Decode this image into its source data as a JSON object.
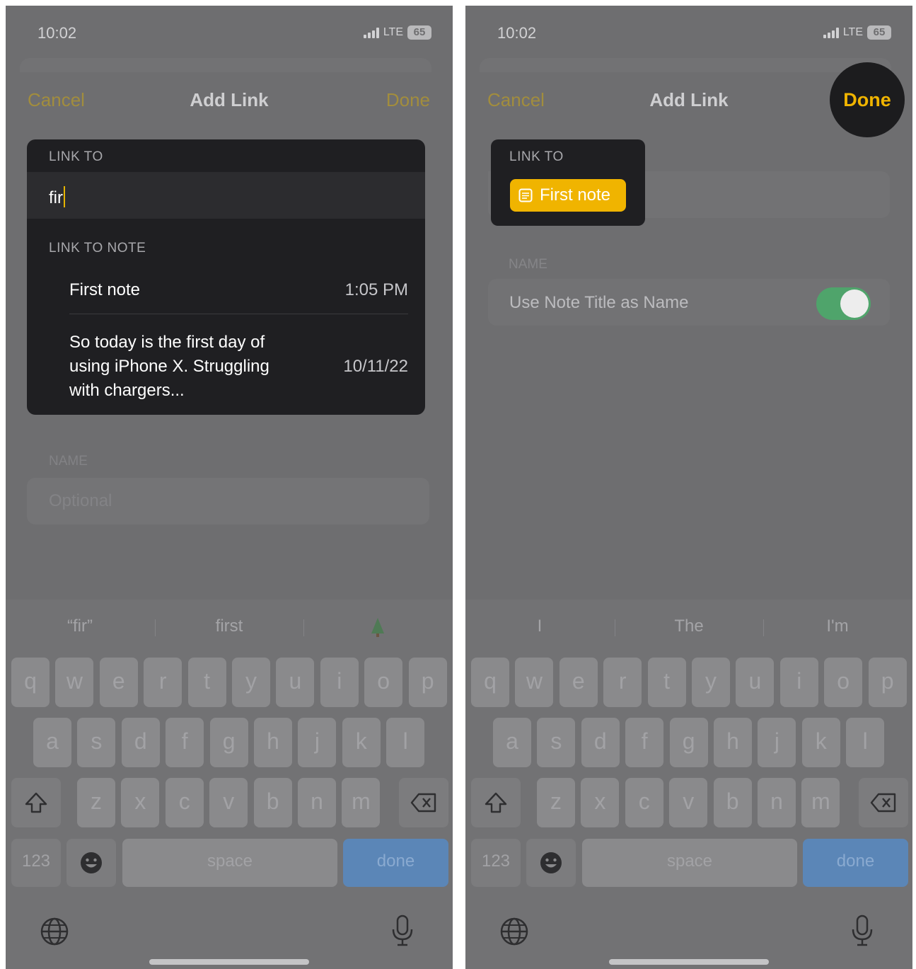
{
  "status": {
    "time": "10:02",
    "network": "LTE",
    "battery": "65"
  },
  "nav": {
    "cancel": "Cancel",
    "title": "Add Link",
    "done": "Done"
  },
  "left": {
    "link_to_label": "LINK TO",
    "input_value": "fir",
    "link_to_note_label": "LINK TO NOTE",
    "results": [
      {
        "title_lines": [
          "First note"
        ],
        "date": "1:05 PM"
      },
      {
        "title_lines": [
          "So today is the first day of",
          "using iPhone X. Struggling",
          "with chargers..."
        ],
        "date": "10/11/22"
      }
    ],
    "name_label": "NAME",
    "name_placeholder": "Optional",
    "suggestions": [
      "“fir”",
      "first",
      "🌲"
    ]
  },
  "right": {
    "link_to_label": "LINK TO",
    "linked_note_chip": "First note",
    "name_label": "NAME",
    "use_note_title_label": "Use Note Title as Name",
    "use_note_title_enabled": true,
    "suggestions": [
      "I",
      "The",
      "I'm"
    ]
  },
  "keyboard": {
    "row1": [
      "q",
      "w",
      "e",
      "r",
      "t",
      "y",
      "u",
      "i",
      "o",
      "p"
    ],
    "row2": [
      "a",
      "s",
      "d",
      "f",
      "g",
      "h",
      "j",
      "k",
      "l"
    ],
    "row3": [
      "z",
      "x",
      "c",
      "v",
      "b",
      "n",
      "m"
    ],
    "numbers_key": "123",
    "space_key": "space",
    "done_key": "done"
  },
  "colors": {
    "accent": "#f0b400",
    "dimmed_accent": "#a28d3d",
    "toggle_on": "#4fa46b",
    "keyboard_done": "#5b86b7"
  }
}
